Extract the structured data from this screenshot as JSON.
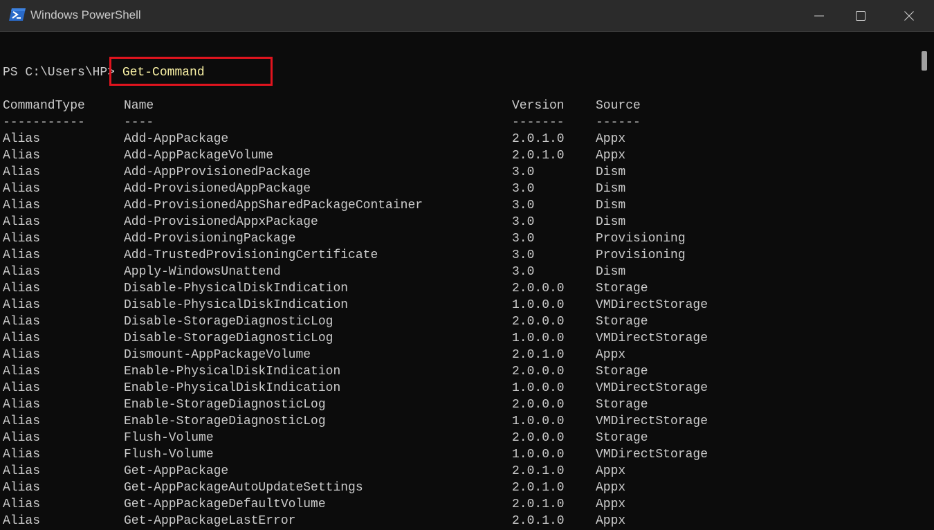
{
  "window": {
    "title": "Windows PowerShell",
    "icon": "powershell-icon",
    "controls": [
      "minimize-icon",
      "maximize-icon",
      "close-icon"
    ]
  },
  "console": {
    "prompt": "PS C:\\Users\\HP> ",
    "command": "Get-Command",
    "highlight_color": "#e0141e",
    "command_color": "#f9f1a5",
    "columns": [
      "CommandType",
      "Name",
      "Version",
      "Source"
    ],
    "separators": [
      "-----------",
      "----",
      "-------",
      "------"
    ],
    "rows": [
      [
        "Alias",
        "Add-AppPackage",
        "2.0.1.0",
        "Appx"
      ],
      [
        "Alias",
        "Add-AppPackageVolume",
        "2.0.1.0",
        "Appx"
      ],
      [
        "Alias",
        "Add-AppProvisionedPackage",
        "3.0",
        "Dism"
      ],
      [
        "Alias",
        "Add-ProvisionedAppPackage",
        "3.0",
        "Dism"
      ],
      [
        "Alias",
        "Add-ProvisionedAppSharedPackageContainer",
        "3.0",
        "Dism"
      ],
      [
        "Alias",
        "Add-ProvisionedAppxPackage",
        "3.0",
        "Dism"
      ],
      [
        "Alias",
        "Add-ProvisioningPackage",
        "3.0",
        "Provisioning"
      ],
      [
        "Alias",
        "Add-TrustedProvisioningCertificate",
        "3.0",
        "Provisioning"
      ],
      [
        "Alias",
        "Apply-WindowsUnattend",
        "3.0",
        "Dism"
      ],
      [
        "Alias",
        "Disable-PhysicalDiskIndication",
        "2.0.0.0",
        "Storage"
      ],
      [
        "Alias",
        "Disable-PhysicalDiskIndication",
        "1.0.0.0",
        "VMDirectStorage"
      ],
      [
        "Alias",
        "Disable-StorageDiagnosticLog",
        "2.0.0.0",
        "Storage"
      ],
      [
        "Alias",
        "Disable-StorageDiagnosticLog",
        "1.0.0.0",
        "VMDirectStorage"
      ],
      [
        "Alias",
        "Dismount-AppPackageVolume",
        "2.0.1.0",
        "Appx"
      ],
      [
        "Alias",
        "Enable-PhysicalDiskIndication",
        "2.0.0.0",
        "Storage"
      ],
      [
        "Alias",
        "Enable-PhysicalDiskIndication",
        "1.0.0.0",
        "VMDirectStorage"
      ],
      [
        "Alias",
        "Enable-StorageDiagnosticLog",
        "2.0.0.0",
        "Storage"
      ],
      [
        "Alias",
        "Enable-StorageDiagnosticLog",
        "1.0.0.0",
        "VMDirectStorage"
      ],
      [
        "Alias",
        "Flush-Volume",
        "2.0.0.0",
        "Storage"
      ],
      [
        "Alias",
        "Flush-Volume",
        "1.0.0.0",
        "VMDirectStorage"
      ],
      [
        "Alias",
        "Get-AppPackage",
        "2.0.1.0",
        "Appx"
      ],
      [
        "Alias",
        "Get-AppPackageAutoUpdateSettings",
        "2.0.1.0",
        "Appx"
      ],
      [
        "Alias",
        "Get-AppPackageDefaultVolume",
        "2.0.1.0",
        "Appx"
      ],
      [
        "Alias",
        "Get-AppPackageLastError",
        "2.0.1.0",
        "Appx"
      ]
    ]
  }
}
